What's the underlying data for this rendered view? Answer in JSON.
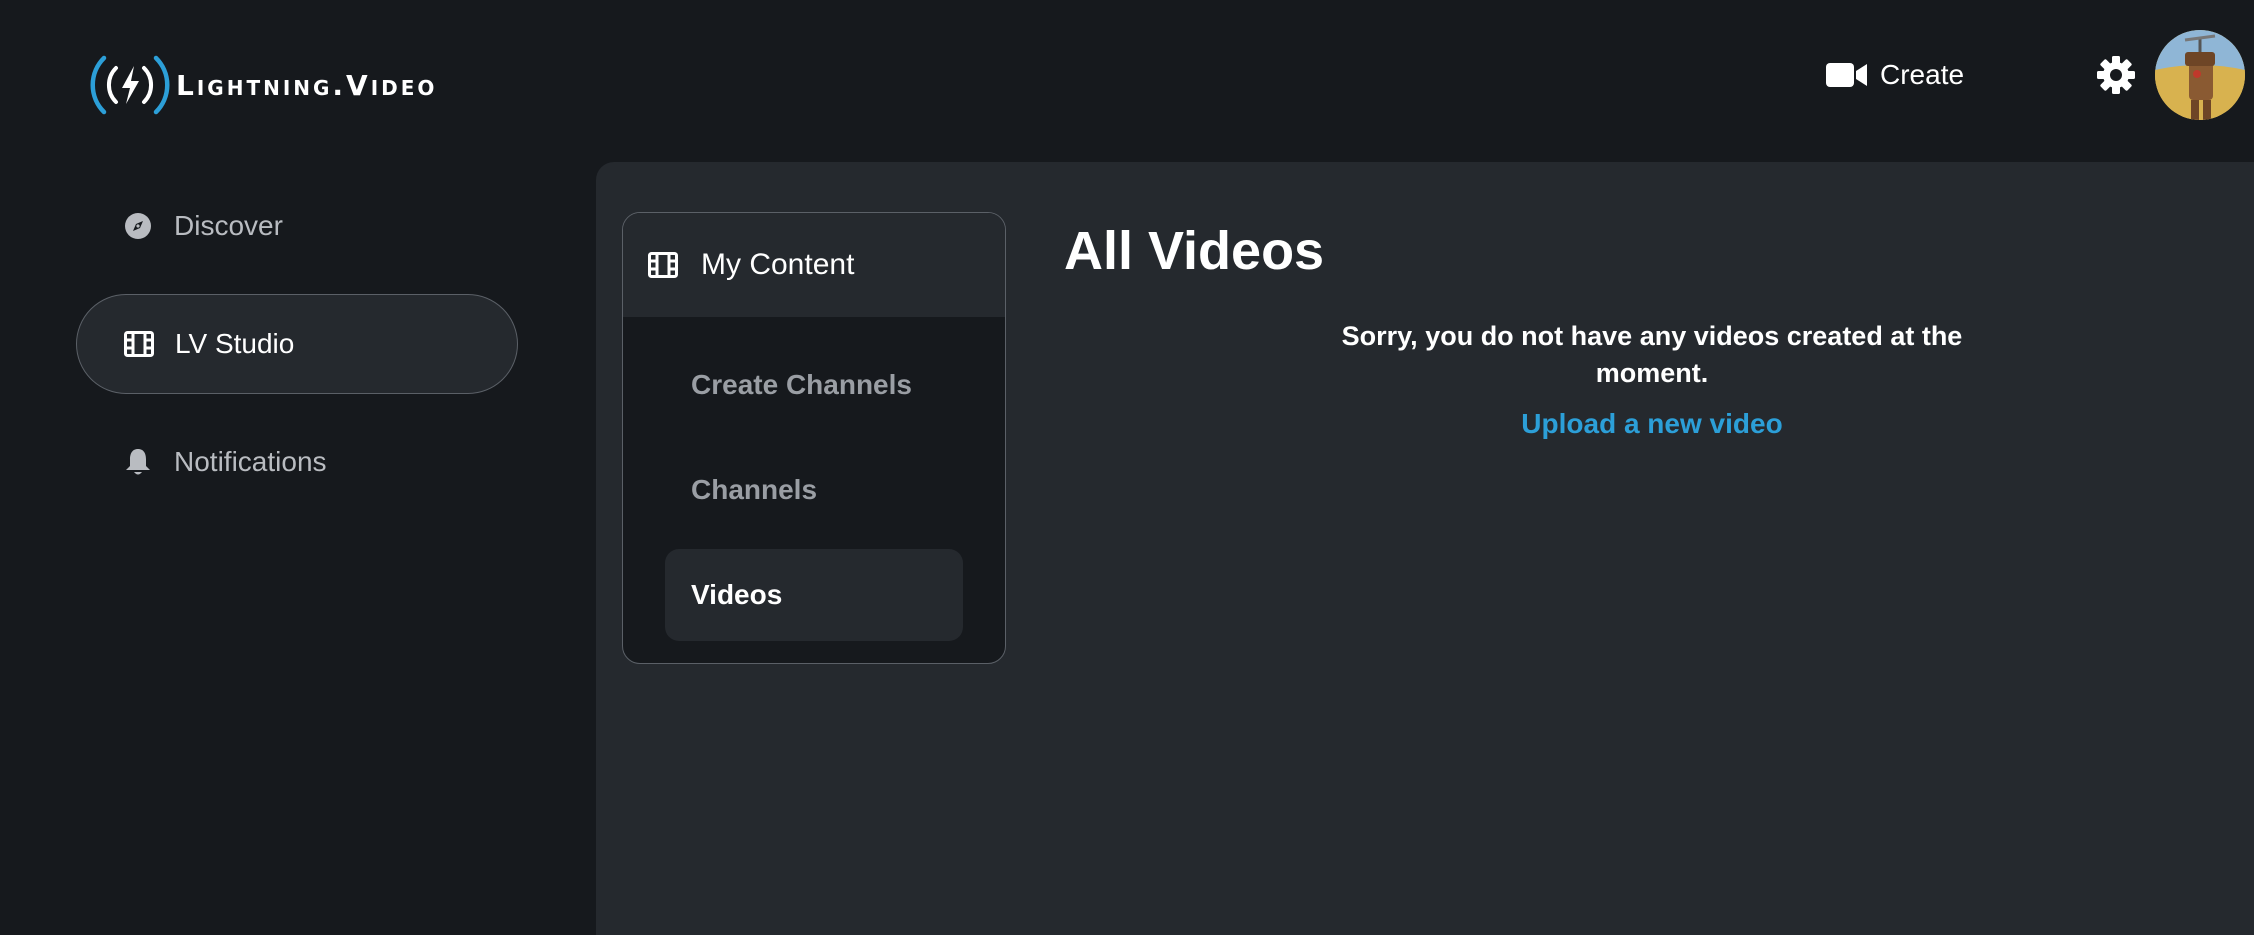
{
  "header": {
    "logo_text": "Lightning.Video",
    "create_label": "Create"
  },
  "sidebar": {
    "items": [
      {
        "label": "Discover",
        "icon": "compass-icon",
        "active": false
      },
      {
        "label": "LV Studio",
        "icon": "film-icon",
        "active": true
      },
      {
        "label": "Notifications",
        "icon": "bell-icon",
        "active": false
      }
    ]
  },
  "studio": {
    "card_title": "My Content",
    "menu": [
      {
        "label": "Create Channels",
        "active": false
      },
      {
        "label": "Channels",
        "active": false
      },
      {
        "label": "Videos",
        "active": true
      }
    ]
  },
  "content": {
    "title": "All Videos",
    "empty_message": "Sorry, you do not have any videos created at the moment.",
    "upload_link": "Upload a new video"
  },
  "colors": {
    "background": "#16191d",
    "panel": "#25292e",
    "accent": "#2c9fd8",
    "border": "#5b6067"
  }
}
